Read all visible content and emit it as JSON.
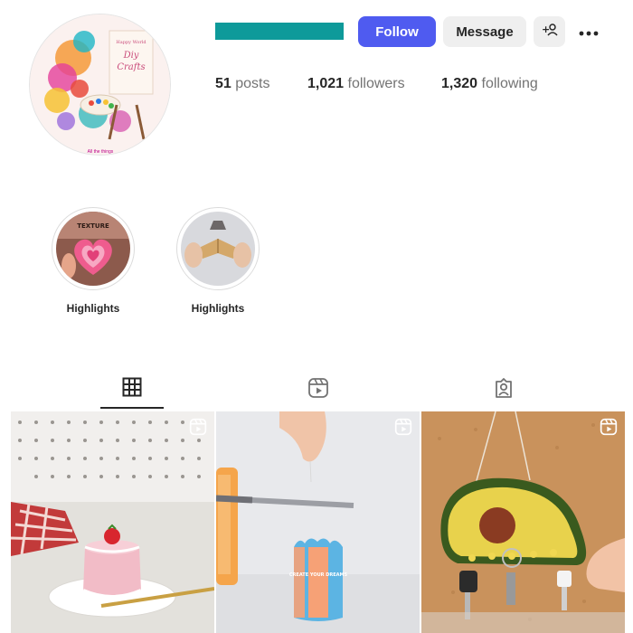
{
  "profile": {
    "avatar_text": {
      "line1": "Happy World",
      "line2": "Diy",
      "line3": "Crafts",
      "bottom": "All the things"
    },
    "username_redacted_color": "#0e9a9a"
  },
  "header": {
    "follow_label": "Follow",
    "message_label": "Message",
    "add_user_icon": "add-user-icon",
    "more_icon": "more-options-icon"
  },
  "stats": {
    "posts": {
      "count": "51",
      "label": "posts"
    },
    "followers": {
      "count": "1,021",
      "label": "followers"
    },
    "following": {
      "count": "1,320",
      "label": "following"
    }
  },
  "highlights": [
    {
      "label": "Highlights",
      "cover_text": "TEXTURE"
    },
    {
      "label": "Highlights"
    }
  ],
  "tabs": [
    {
      "icon": "grid-icon",
      "active": true
    },
    {
      "icon": "reels-icon",
      "active": false
    },
    {
      "icon": "tagged-icon",
      "active": false
    }
  ],
  "posts": [
    {
      "type": "reel",
      "subject": "pink cake candle"
    },
    {
      "type": "reel",
      "subject": "painted pencil cup",
      "cup_text": "CREATE YOUR DREAMS"
    },
    {
      "type": "reel",
      "subject": "avocado key holder"
    }
  ],
  "colors": {
    "accent": "#4f5bf0",
    "button_gray": "#efefef",
    "text": "#262626",
    "muted": "#737373"
  }
}
